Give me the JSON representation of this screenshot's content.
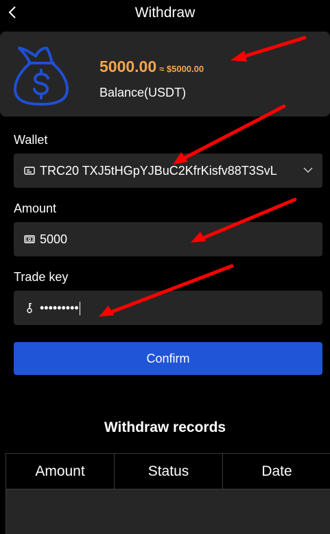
{
  "header": {
    "title": "Withdraw"
  },
  "balance": {
    "amount": "5000.00",
    "approx": "≈ $5000.00",
    "label": "Balance(USDT)"
  },
  "form": {
    "wallet": {
      "label": "Wallet",
      "value": "TRC20 TXJ5tHGpYJBuC2KfrKisfv88T3SvL"
    },
    "amount": {
      "label": "Amount",
      "value": "5000"
    },
    "trade_key": {
      "label": "Trade key",
      "value": "•••••••••"
    },
    "confirm_label": "Confirm"
  },
  "records": {
    "title": "Withdraw records",
    "columns": [
      "Amount",
      "Status",
      "Date"
    ]
  },
  "colors": {
    "background": "#000000",
    "card": "#262626",
    "accent_orange": "#f5a64a",
    "button_blue": "#1f55d6",
    "icon_blue": "#1f4fd6",
    "annotation_red": "#ff0000"
  },
  "icons": {
    "back": "chevron-left-icon",
    "balance": "money-bag-icon",
    "wallet": "card-icon",
    "amount": "cash-icon",
    "trade_key": "key-icon",
    "dropdown": "chevron-down-icon"
  }
}
